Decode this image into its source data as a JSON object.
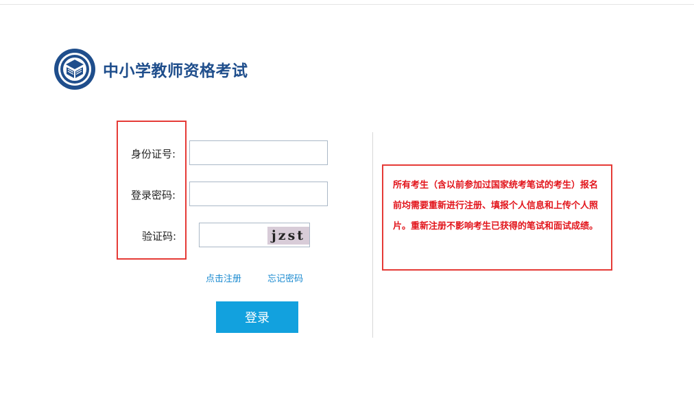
{
  "header": {
    "site_title": "中小学教师资格考试"
  },
  "login_form": {
    "id_label": "身份证号:",
    "password_label": "登录密码:",
    "captcha_label": "验证码:",
    "captcha_text": "jzst",
    "register_link": "点击注册",
    "forgot_link": "忘记密码",
    "login_button": "登录"
  },
  "notice": {
    "text": "所有考生（含以前参加过国家统考笔试的考生）报名前均需要重新进行注册、填报个人信息和上传个人照片。重新注册不影响考生已获得的笔试和面试成绩。"
  },
  "colors": {
    "brand_blue": "#1f4e8c",
    "button_blue": "#12a1de",
    "link_blue": "#1a8ad0",
    "highlight_red": "#e53935",
    "notice_red": "#e2141b"
  }
}
